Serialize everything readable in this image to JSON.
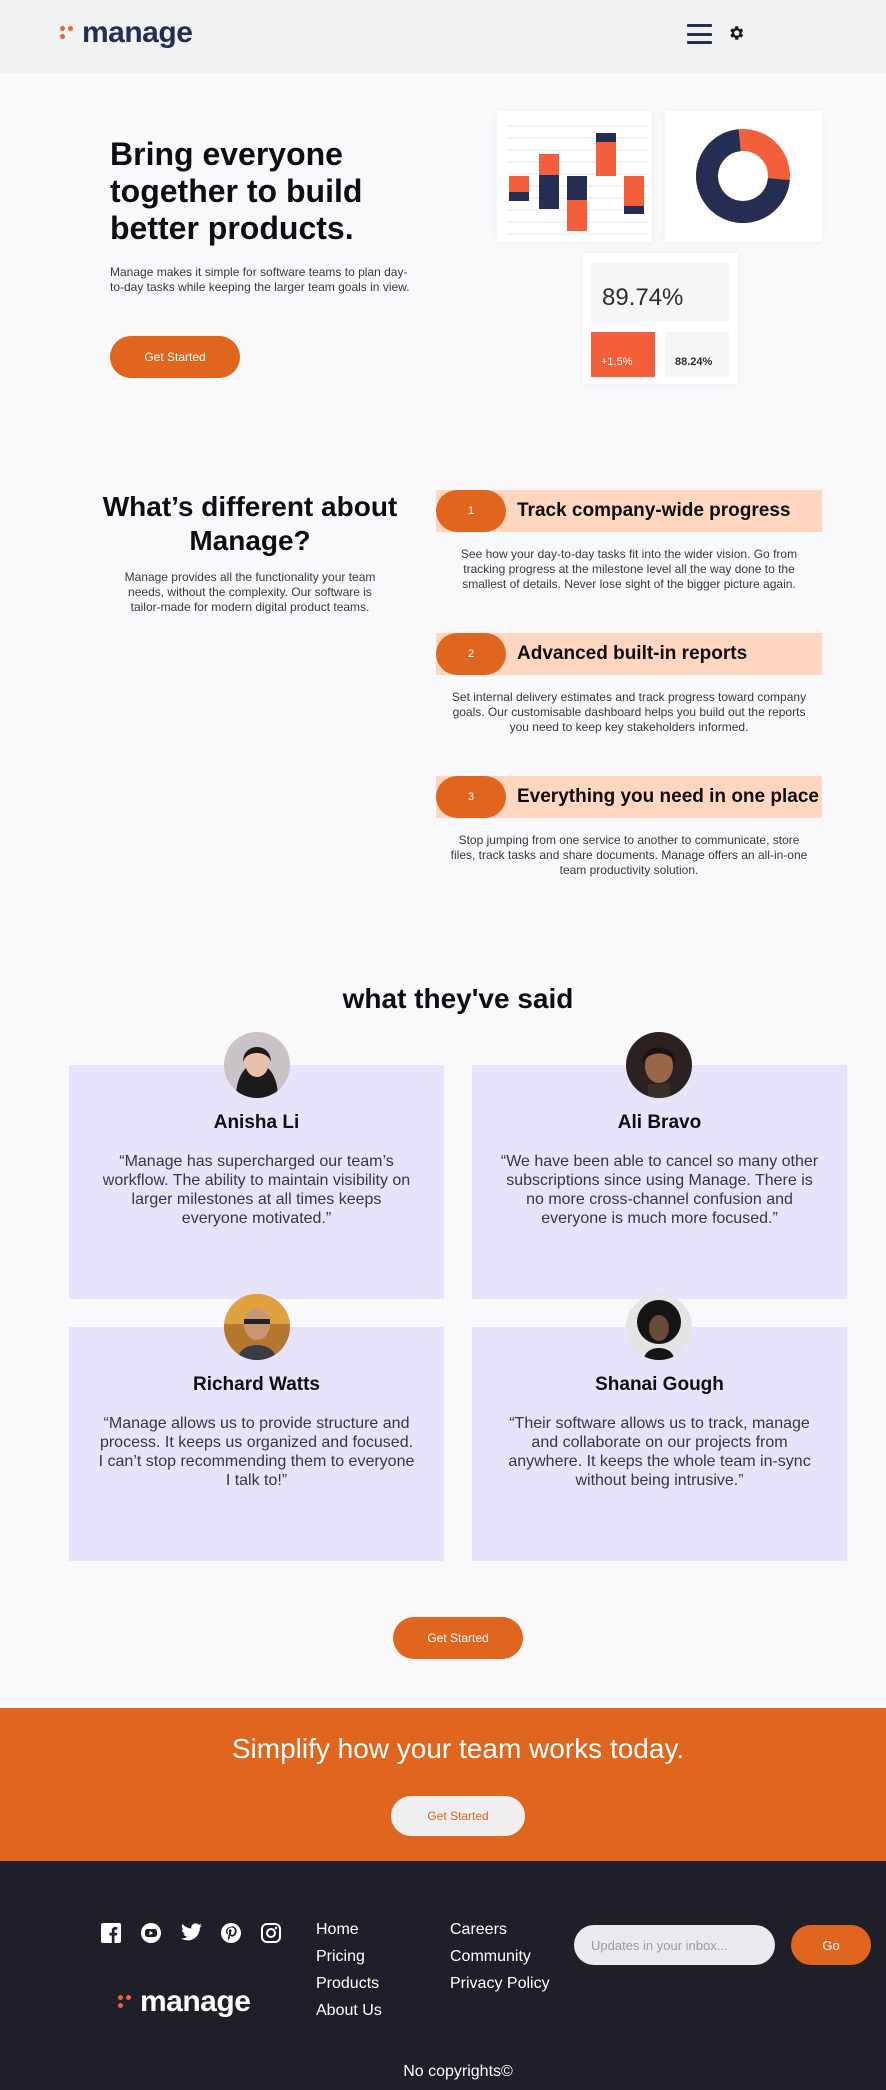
{
  "header": {
    "brand": "manage",
    "menu_icon": "hamburger-icon",
    "settings_icon": "gear-icon"
  },
  "hero": {
    "title_line1": "Bring everyone",
    "title_line2": "together to build",
    "title_line3": "better products.",
    "text_line1": "Manage makes it simple for software teams to plan day-",
    "text_line2": "to-day tasks while keeping the larger team goals in view.",
    "cta": "Get Started",
    "stats": {
      "main": "89.74%",
      "change": "+1.5%",
      "secondary": "88.24%"
    },
    "donut_fill_fraction": 0.72
  },
  "different": {
    "title_line1": "What’s different about",
    "title_line2": "Manage?",
    "text_line1": "Manage provides all the functionality your team",
    "text_line2": "needs, without the complexity. Our software is",
    "text_line3": "tailor-made for modern digital product teams."
  },
  "features": [
    {
      "num": "1",
      "title": "Track company-wide progress",
      "l1": "See how your day-to-day tasks fit into the wider vision. Go from",
      "l2": "tracking progress at the milestone level all the way done to the",
      "l3": "smallest of details. Never lose sight of the bigger picture again."
    },
    {
      "num": "2",
      "title": "Advanced built-in reports",
      "l1": "Set internal delivery estimates and track progress toward company",
      "l2": "goals. Our customisable dashboard helps you build out the reports",
      "l3": "you need to keep key stakeholders informed."
    },
    {
      "num": "3",
      "title": "Everything you need in one place",
      "l1": "Stop jumping from one service to another to communicate, store",
      "l2": "files, track tasks and share documents. Manage offers an all-in-one",
      "l3": "team productivity solution."
    }
  ],
  "testimonials": {
    "title": "what they've said",
    "items": [
      {
        "name": "Anisha Li",
        "l1": "“Manage has supercharged our team’s",
        "l2": "workflow. The ability to maintain visibility on",
        "l3": "larger milestones at all times keeps",
        "l4": "everyone motivated.”"
      },
      {
        "name": "Ali Bravo",
        "l1": "“We have been able to cancel so many other",
        "l2": "subscriptions since using Manage. There is",
        "l3": "no more cross-channel confusion and",
        "l4": "everyone is much more focused.”"
      },
      {
        "name": "Richard Watts",
        "l1": "“Manage allows us to provide structure and",
        "l2": "process. It keeps us organized and focused.",
        "l3": "I can’t stop recommending them to everyone",
        "l4": "I talk to!”"
      },
      {
        "name": "Shanai Gough",
        "l1": "“Their software allows us to track, manage",
        "l2": "and collaborate on our projects from",
        "l3": "anywhere. It keeps the whole team in-sync",
        "l4": "without being intrusive.”"
      }
    ],
    "cta": "Get Started"
  },
  "cta_band": {
    "text": "Simplify how your team works today.",
    "button": "Get Started"
  },
  "footer": {
    "social_icons": [
      "facebook-icon",
      "youtube-icon",
      "twitter-icon",
      "pinterest-icon",
      "instagram-icon"
    ],
    "brand": "manage",
    "links_col1": [
      "Home",
      "Pricing",
      "Products",
      "About Us"
    ],
    "links_col2": [
      "Careers",
      "Community",
      "Privacy Policy"
    ],
    "subscribe_placeholder": "Updates in your inbox...",
    "go": "Go",
    "copyright": "No copyrights©"
  },
  "colors": {
    "accent": "#e0661f",
    "navy": "#242d52",
    "chart_orange": "#f25f3a",
    "card_lavender": "#e7e3fa",
    "feature_peach": "#ffd7c0",
    "footer_bg": "#1f1f2a"
  }
}
